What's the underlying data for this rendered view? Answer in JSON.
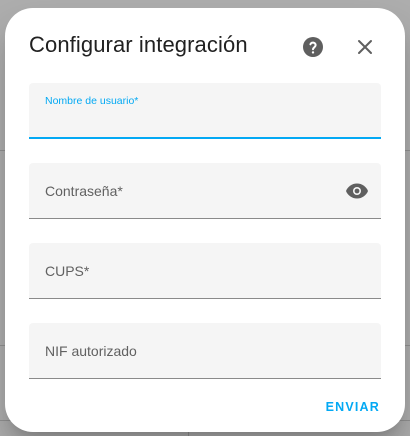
{
  "dialog": {
    "title": "Configurar integración",
    "fields": {
      "username": {
        "label": "Nombre de usuario*",
        "value": ""
      },
      "password": {
        "label": "Contraseña*",
        "value": ""
      },
      "cups": {
        "label": "CUPS*",
        "value": ""
      },
      "nif": {
        "label": "NIF autorizado",
        "value": ""
      }
    },
    "submit_label": "ENVIAR"
  },
  "icons": {
    "help": "help-circle-icon",
    "close": "close-icon",
    "password_toggle": "eye-icon"
  },
  "colors": {
    "accent": "#03a9f4",
    "field_background": "#f5f5f5",
    "scrim": "rgba(0,0,0,0.32)"
  }
}
